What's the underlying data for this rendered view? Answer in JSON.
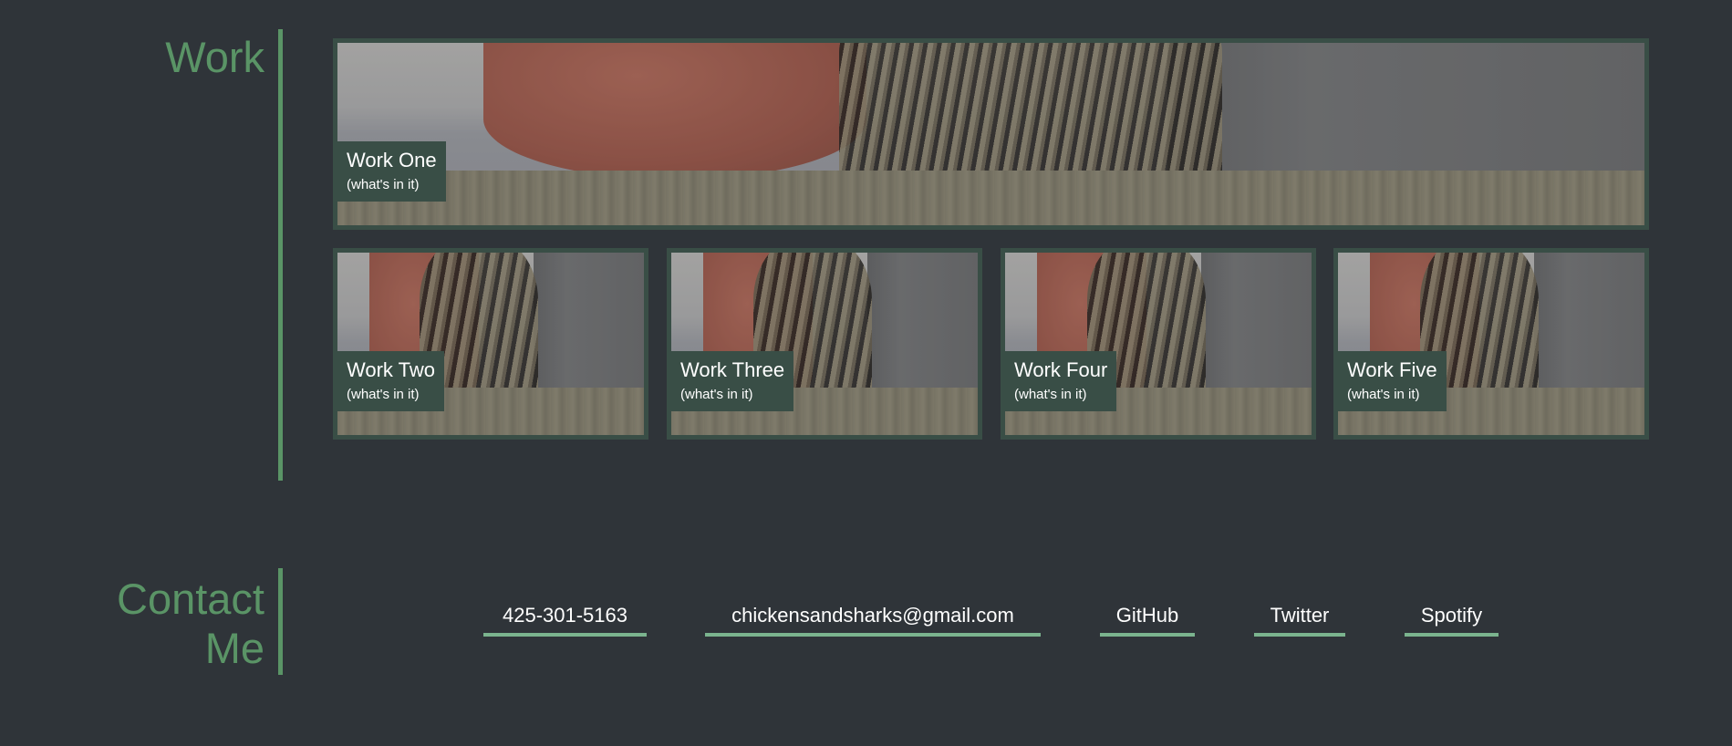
{
  "work": {
    "heading": "Work",
    "tiles": [
      {
        "title": "Work One",
        "subtitle": "(what's in it)"
      },
      {
        "title": "Work Two",
        "subtitle": "(what's in it)"
      },
      {
        "title": "Work Three",
        "subtitle": "(what's in it)"
      },
      {
        "title": "Work Four",
        "subtitle": "(what's in it)"
      },
      {
        "title": "Work Five",
        "subtitle": "(what's in it)"
      }
    ]
  },
  "contact": {
    "heading_line1": "Contact",
    "heading_line2": "Me",
    "links": [
      {
        "label": "425-301-5163"
      },
      {
        "label": "chickensandsharks@gmail.com"
      },
      {
        "label": "GitHub"
      },
      {
        "label": "Twitter"
      },
      {
        "label": "Spotify"
      }
    ]
  },
  "colors": {
    "background": "#2f3439",
    "accent_green": "#5a9466",
    "tile_border": "#394e46",
    "link_underline": "#7bb48e",
    "text": "#ffffff"
  }
}
